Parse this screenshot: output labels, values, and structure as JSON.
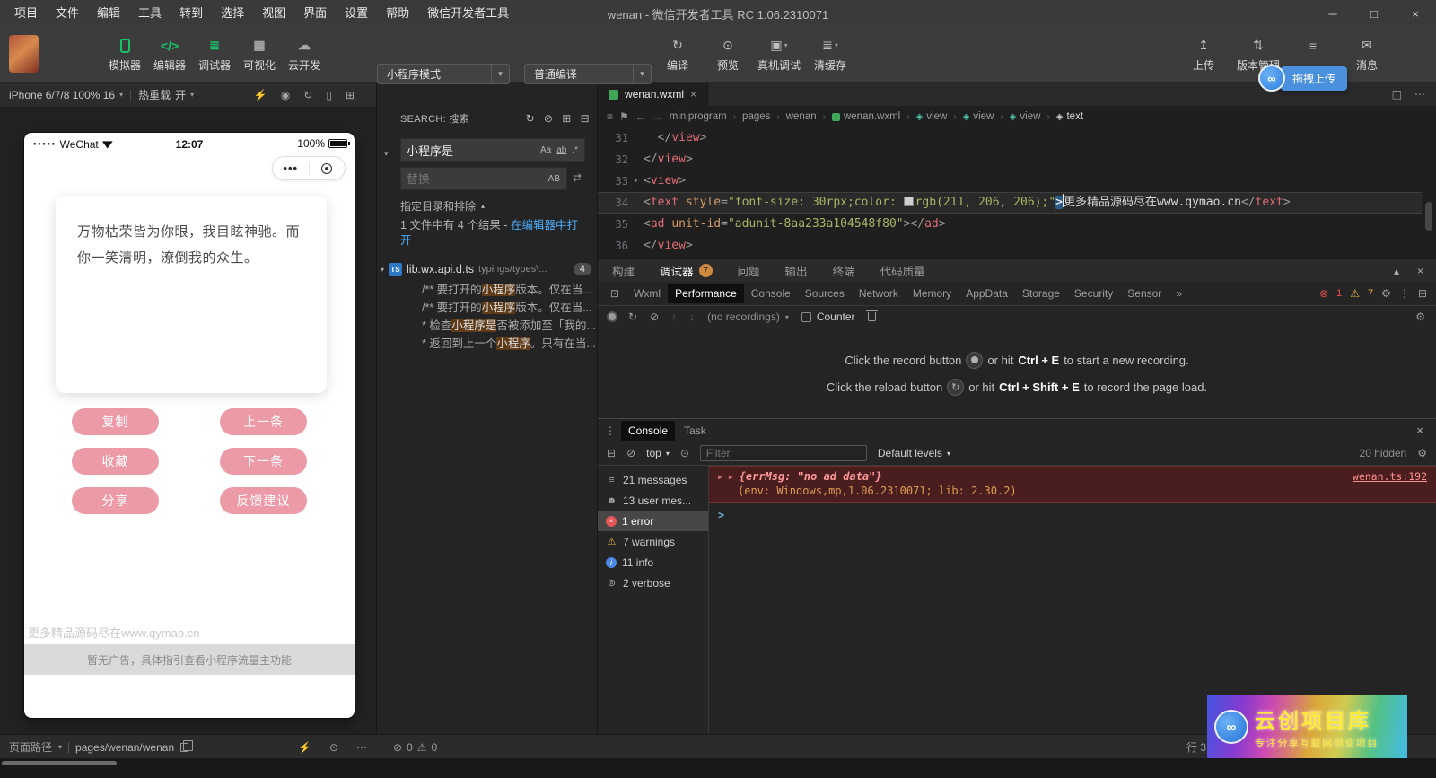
{
  "icons": {
    "minimize": "─",
    "maximize": "□",
    "close": "×",
    "caret_down": "▾",
    "caret_up": "▴",
    "chevron_right": "›",
    "list": "≡",
    "bookmark": "⚑",
    "back": "←",
    "forward": "→",
    "split": "◫",
    "more_h": "⋯",
    "more_v": "⋮",
    "dock": "⊡",
    "dock_bottom": "⊟",
    "gear": "⚙",
    "warning": "⚠",
    "error_circle": "⊗",
    "block": "⊘",
    "import": "↑",
    "export": "↓",
    "more_tabs": "»",
    "eye": "⊙",
    "twisty": "▶",
    "refresh": "↻",
    "replace_all": "⇄",
    "ts": "TS",
    "logo": "∞",
    "flash": "⚡",
    "prompt": ">"
  },
  "titlebar": {
    "menus": [
      "项目",
      "文件",
      "编辑",
      "工具",
      "转到",
      "选择",
      "视图",
      "界面",
      "设置",
      "帮助",
      "微信开发者工具"
    ],
    "title": "wenan - 微信开发者工具 RC 1.06.2310071"
  },
  "toolbar": {
    "main_buttons": [
      {
        "label": "模拟器",
        "icon": "simulator-icon",
        "glyph": "",
        "green": true
      },
      {
        "label": "编辑器",
        "icon": "editor-icon",
        "glyph": "</>",
        "green": true
      },
      {
        "label": "调试器",
        "icon": "debugger-icon",
        "glyph": "≣",
        "green": true
      },
      {
        "label": "可视化",
        "icon": "visualization-icon",
        "glyph": "▦",
        "green": false
      },
      {
        "label": "云开发",
        "icon": "cloud-dev-icon",
        "glyph": "☁",
        "green": false
      }
    ],
    "mode_select": "小程序模式",
    "compile_select": "普通编译",
    "action_buttons": [
      {
        "label": "编译",
        "icon": "compile-icon",
        "glyph": "↻",
        "caret": false
      },
      {
        "label": "预览",
        "icon": "preview-icon",
        "glyph": "⊙",
        "caret": false
      },
      {
        "label": "真机调试",
        "icon": "remote-debug-icon",
        "glyph": "▣",
        "caret": true
      },
      {
        "label": "清缓存",
        "icon": "clear-cache-icon",
        "glyph": "≣",
        "caret": true
      }
    ],
    "right_buttons": [
      {
        "label": "上传",
        "icon": "upload-icon",
        "glyph": "↥"
      },
      {
        "label": "版本管理",
        "icon": "version-icon",
        "glyph": "⇅"
      },
      {
        "label": "",
        "icon": "toolbar-extra-icon",
        "glyph": "≡"
      },
      {
        "label": "消息",
        "icon": "message-icon",
        "glyph": "✉"
      }
    ]
  },
  "overlay": {
    "drag_upload": "拖拽上传",
    "wm_title": "云创项目库",
    "wm_subtitle": "专注分享互联网创业项目"
  },
  "simulator": {
    "device_select": "iPhone 6/7/8 100% 16",
    "hot_reload_label": "热重载",
    "hot_reload_state": "开",
    "icons": [
      {
        "icon": "signal-icon",
        "glyph": "⚡"
      },
      {
        "icon": "record-icon",
        "glyph": "◉"
      },
      {
        "icon": "refresh-icon",
        "glyph": "↻"
      },
      {
        "icon": "device-icon",
        "glyph": "▯"
      },
      {
        "icon": "detach-window-icon",
        "glyph": "⊞"
      }
    ],
    "phone": {
      "signal_dots": "●●●●●",
      "carrier": "WeChat",
      "time": "12:07",
      "battery": "100%",
      "capsule_dots": "•••",
      "card_text": "万物枯荣皆为你眼，我目眩神驰。而你一笑清明，潦倒我的众生。",
      "buttons": [
        "复制",
        "上一条",
        "收藏",
        "下一条",
        "分享",
        "反馈建议"
      ],
      "watermark": "更多精品源码尽在www.qymao.cn",
      "ad_text": "暂无广告，具体指引查看小程序流量主功能"
    }
  },
  "search": {
    "title": "SEARCH: 搜索",
    "header_icons": [
      {
        "icon": "refresh-icon",
        "glyph": "↻"
      },
      {
        "icon": "clear-results-icon",
        "glyph": "⊘"
      },
      {
        "icon": "open-in-editor-icon",
        "glyph": "⊞"
      },
      {
        "icon": "collapse-icon",
        "glyph": "⊟"
      }
    ],
    "query": "小程序是",
    "opt_case": "Aa",
    "opt_word": "ab",
    "opt_regex": ".*",
    "opt_preserve": "AB",
    "replace_placeholder": "替换",
    "dirs_label": "指定目录和排除",
    "summary_prefix": "1 文件中有 4 个结果 - ",
    "summary_link": "在编辑器中打开",
    "file": {
      "name": "lib.wx.api.d.ts",
      "path": "typings/types\\...",
      "count": "4"
    },
    "results": [
      {
        "pre": "/** 要打开的",
        "match": "小程序",
        "post": "版本。仅在当..."
      },
      {
        "pre": "/** 要打开的",
        "match": "小程序",
        "post": "版本。仅在当..."
      },
      {
        "pre": "* 检查",
        "match": "小程序是",
        "post": "否被添加至「我的..."
      },
      {
        "pre": "* 返回到上一个",
        "match": "小程序",
        "post": "。只有在当..."
      }
    ]
  },
  "editor": {
    "tab": "wenan.wxml",
    "breadcrumb": [
      {
        "label": "miniprogram"
      },
      {
        "label": "pages"
      },
      {
        "label": "wenan"
      },
      {
        "label": "wenan.wxml",
        "icon": "wxml-file-icon"
      },
      {
        "label": "view",
        "icon": "symbol-icon"
      },
      {
        "label": "view",
        "icon": "symbol-icon"
      },
      {
        "label": "view",
        "icon": "symbol-icon"
      },
      {
        "label": "text",
        "icon": "symbol-icon",
        "current": true
      }
    ],
    "symbol_glyph": "◈",
    "lines": [
      {
        "num": "31",
        "tokens": [
          {
            "t": "  "
          },
          {
            "t": "</",
            "c": "punct"
          },
          {
            "t": "view",
            "c": "tag"
          },
          {
            "t": ">",
            "c": "punct"
          }
        ]
      },
      {
        "num": "32",
        "tokens": [
          {
            "t": "</",
            "c": "punct"
          },
          {
            "t": "view",
            "c": "tag"
          },
          {
            "t": ">",
            "c": "punct"
          }
        ]
      },
      {
        "num": "33",
        "fold": true,
        "tokens": [
          {
            "t": "<",
            "c": "punct"
          },
          {
            "t": "view",
            "c": "tag"
          },
          {
            "t": ">",
            "c": "punct"
          }
        ]
      },
      {
        "num": "34",
        "current": true,
        "tokens": [
          {
            "t": "<",
            "c": "punct"
          },
          {
            "t": "text",
            "c": "tag"
          },
          {
            "t": " "
          },
          {
            "t": "style",
            "c": "attr"
          },
          {
            "t": "=",
            "c": "punct"
          },
          {
            "t": "\"font-size: 30rpx;color: ",
            "c": "string"
          },
          {
            "c": "swatch",
            "color": "rgb(211, 206, 206)"
          },
          {
            "t": "rgb(211, 206, 206);\"",
            "c": "string"
          },
          {
            "t": ">",
            "c": "sel"
          },
          {
            "t": "更多精品源码尽在www.qymao.cn"
          },
          {
            "t": "</",
            "c": "punct"
          },
          {
            "t": "text",
            "c": "tag"
          },
          {
            "t": ">",
            "c": "punct"
          }
        ]
      },
      {
        "num": "35",
        "tokens": [
          {
            "t": "<",
            "c": "punct"
          },
          {
            "t": "ad",
            "c": "tag"
          },
          {
            "t": " "
          },
          {
            "t": "unit-id",
            "c": "attr"
          },
          {
            "t": "=",
            "c": "punct"
          },
          {
            "t": "\"adunit-8aa233a104548f80\"",
            "c": "string"
          },
          {
            "t": "></",
            "c": "punct"
          },
          {
            "t": "ad",
            "c": "tag"
          },
          {
            "t": ">",
            "c": "punct"
          }
        ]
      },
      {
        "num": "36",
        "tokens": [
          {
            "t": "</",
            "c": "punct"
          },
          {
            "t": "view",
            "c": "tag"
          },
          {
            "t": ">",
            "c": "punct"
          }
        ]
      }
    ]
  },
  "debugger": {
    "tabs": [
      {
        "label": "构建"
      },
      {
        "label": "调试器",
        "badge": "7",
        "active": true
      },
      {
        "label": "问题"
      },
      {
        "label": "输出"
      },
      {
        "label": "终端"
      },
      {
        "label": "代码质量"
      }
    ],
    "devtools_tabs": [
      "Wxml",
      "Performance",
      "Console",
      "Sources",
      "Network",
      "Memory",
      "AppData",
      "Storage",
      "Security",
      "Sensor"
    ],
    "active_devtools_tab": "Performance",
    "error_count": "1",
    "warning_count": "7",
    "perf": {
      "recordings": "(no recordings)",
      "counter": "Counter",
      "hint_mid": "or hit",
      "h1_pre": "Click the record button",
      "h1_key": "Ctrl + E",
      "h1_post": "to start a new recording.",
      "h2_pre": "Click the reload button",
      "h2_key": "Ctrl + Shift + E",
      "h2_post": "to record the page load."
    },
    "console": {
      "tabs": [
        {
          "label": "Console",
          "active": true
        },
        {
          "label": "Task"
        }
      ],
      "top": "top",
      "filter_placeholder": "Filter",
      "levels": "Default levels",
      "hidden": "20 hidden",
      "sidebar": [
        {
          "icon": "messages-icon",
          "glyph": "≡",
          "label": "21 messages"
        },
        {
          "icon": "user-messages-icon",
          "glyph": "☻",
          "label": "13 user mes..."
        },
        {
          "icon": "error-icon",
          "glyph": "×",
          "cls": "s-err",
          "label": "1 error",
          "selected": true
        },
        {
          "icon": "warning-icon",
          "glyph": "⚠",
          "cls": "s-warn",
          "label": "7 warnings"
        },
        {
          "icon": "info-icon",
          "glyph": "i",
          "cls": "s-info",
          "label": "11 info"
        },
        {
          "icon": "verbose-icon",
          "glyph": "⊚",
          "label": "2 verbose"
        }
      ],
      "err_obj": "{errMsg: \"no ad data\"}",
      "err_link": "wenan.ts:192",
      "err_env": "(env: Windows,mp,1.06.2310071; lib: 2.30.2)"
    }
  },
  "statusbar": {
    "path_label": "页面路径",
    "path": "pages/wenan/wenan",
    "err": "0",
    "warn": "0",
    "line": "行 3"
  }
}
